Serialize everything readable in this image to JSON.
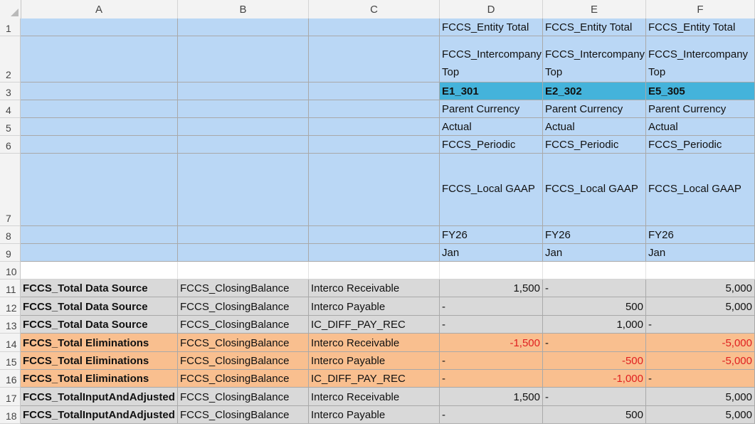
{
  "columns": [
    "A",
    "B",
    "C",
    "D",
    "E",
    "F"
  ],
  "header_rows": [
    {
      "n": "1",
      "d": "FCCS_Entity Total",
      "e": "FCCS_Entity Total",
      "f": "FCCS_Entity Total"
    },
    {
      "n": "2",
      "d": "FCCS_Intercompany Top",
      "e": "FCCS_Intercompany Top",
      "f": "FCCS_Intercompany Top"
    },
    {
      "n": "3",
      "d": "E1_301",
      "e": "E2_302",
      "f": "E5_305"
    },
    {
      "n": "4",
      "d": "Parent Currency",
      "e": "Parent Currency",
      "f": "Parent Currency"
    },
    {
      "n": "5",
      "d": "Actual",
      "e": "Actual",
      "f": "Actual"
    },
    {
      "n": "6",
      "d": "FCCS_Periodic",
      "e": "FCCS_Periodic",
      "f": "FCCS_Periodic"
    },
    {
      "n": "7",
      "d": "FCCS_Local GAAP",
      "e": "FCCS_Local GAAP",
      "f": "FCCS_Local GAAP"
    },
    {
      "n": "8",
      "d": "FY26",
      "e": "FY26",
      "f": "FY26"
    },
    {
      "n": "9",
      "d": "Jan",
      "e": "Jan",
      "f": "Jan"
    }
  ],
  "empty_row": {
    "n": "10"
  },
  "data_rows": [
    {
      "n": "11",
      "a": "FCCS_Total Data Source",
      "b": "FCCS_ClosingBalance",
      "c": "Interco Receivable",
      "d": "1,500",
      "e": "-",
      "f": "5,000"
    },
    {
      "n": "12",
      "a": "FCCS_Total Data Source",
      "b": "FCCS_ClosingBalance",
      "c": "Interco Payable",
      "d": "-",
      "e": "500",
      "f": "5,000"
    },
    {
      "n": "13",
      "a": "FCCS_Total Data Source",
      "b": "FCCS_ClosingBalance",
      "c": "IC_DIFF_PAY_REC",
      "d": "-",
      "e": "1,000",
      "f": "-"
    },
    {
      "n": "14",
      "a": "FCCS_Total Eliminations",
      "b": "FCCS_ClosingBalance",
      "c": "Interco Receivable",
      "d": "-1,500",
      "e": "-",
      "f": "-5,000"
    },
    {
      "n": "15",
      "a": "FCCS_Total Eliminations",
      "b": "FCCS_ClosingBalance",
      "c": "Interco Payable",
      "d": "-",
      "e": "-500",
      "f": "-5,000"
    },
    {
      "n": "16",
      "a": "FCCS_Total Eliminations",
      "b": "FCCS_ClosingBalance",
      "c": "IC_DIFF_PAY_REC",
      "d": "-",
      "e": "-1,000",
      "f": "-"
    },
    {
      "n": "17",
      "a": "FCCS_TotalInputAndAdjusted",
      "b": "FCCS_ClosingBalance",
      "c": "Interco Receivable",
      "d": "1,500",
      "e": "-",
      "f": "5,000"
    },
    {
      "n": "18",
      "a": "FCCS_TotalInputAndAdjusted",
      "b": "FCCS_ClosingBalance",
      "c": "Interco Payable",
      "d": "-",
      "e": "500",
      "f": "5,000"
    }
  ],
  "colors": {
    "header_blue": "#bad7f5",
    "entity_teal": "#44b3db",
    "data_source_grey": "#d9d9d9",
    "eliminations_orange": "#f9bf8f",
    "negative_red": "#e02020"
  }
}
